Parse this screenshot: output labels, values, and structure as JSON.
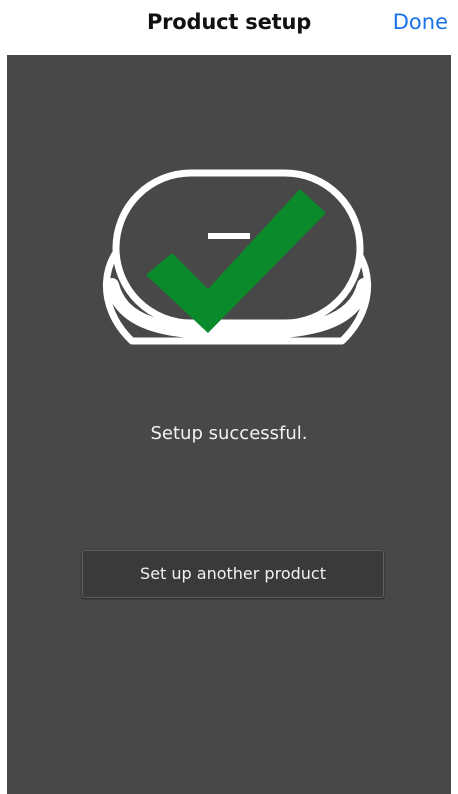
{
  "nav": {
    "title": "Product setup",
    "done_label": "Done"
  },
  "main": {
    "status_message": "Setup successful.",
    "another_product_label": "Set up another product"
  },
  "illustration": {
    "device_icon": "device-outline-icon",
    "check_icon": "checkmark-icon",
    "check_color": "#0a8a2a"
  },
  "colors": {
    "background": "#484848",
    "accent": "#1a73e8"
  }
}
